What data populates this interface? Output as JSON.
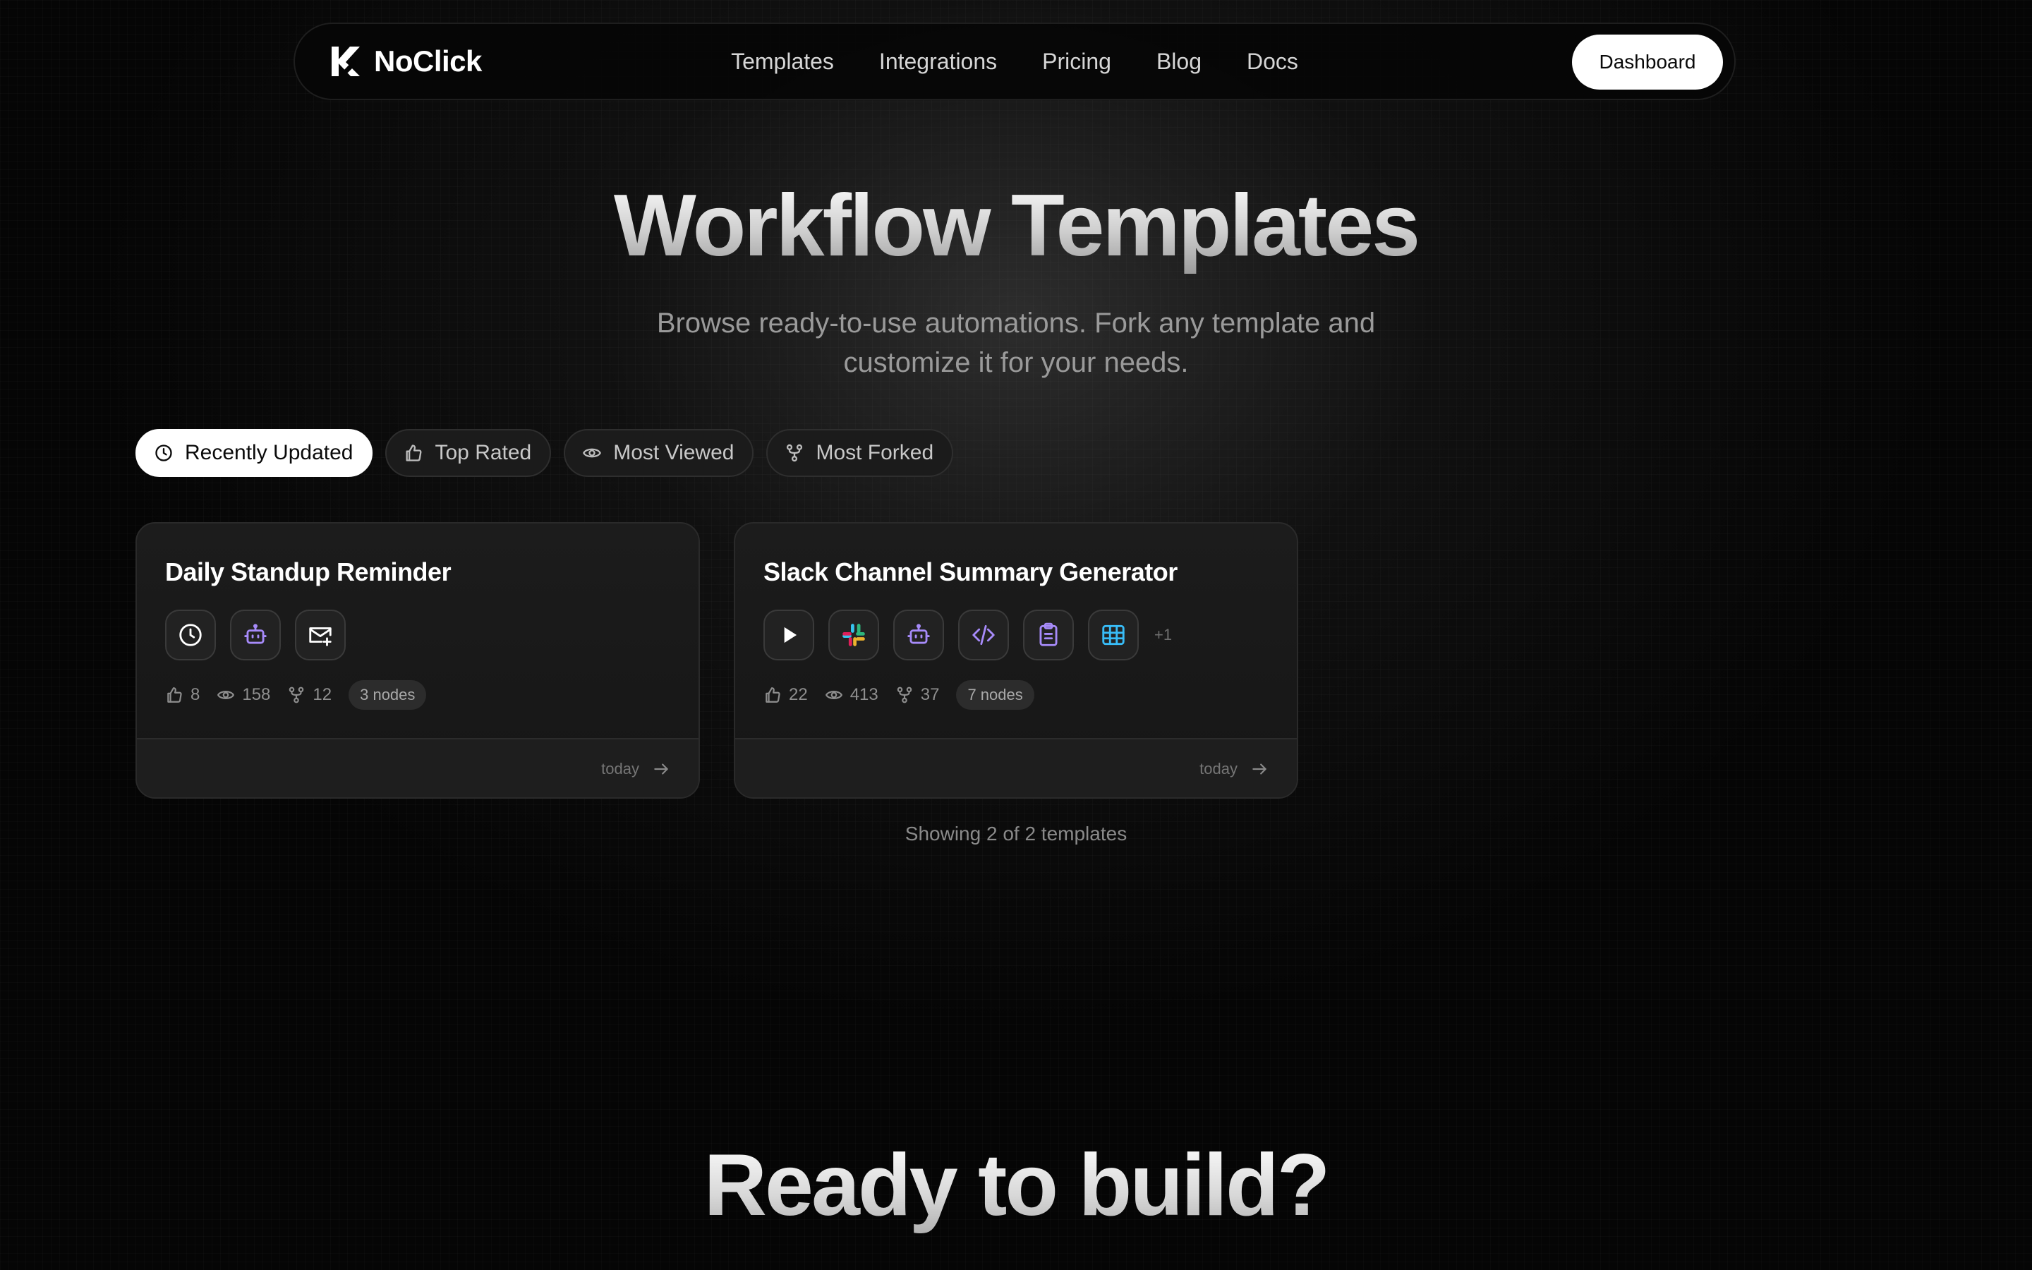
{
  "navbar": {
    "brand": "NoClick",
    "links": [
      "Templates",
      "Integrations",
      "Pricing",
      "Blog",
      "Docs"
    ],
    "dashboard_label": "Dashboard"
  },
  "hero": {
    "title": "Workflow Templates",
    "subtitle": "Browse ready-to-use automations. Fork any template and customize it for your needs."
  },
  "filters": [
    {
      "label": "Recently Updated",
      "icon": "clock-icon",
      "active": true
    },
    {
      "label": "Top Rated",
      "icon": "thumbs-up-icon",
      "active": false
    },
    {
      "label": "Most Viewed",
      "icon": "eye-icon",
      "active": false
    },
    {
      "label": "Most Forked",
      "icon": "fork-icon",
      "active": false
    }
  ],
  "templates": [
    {
      "title": "Daily Standup Reminder",
      "icons": [
        "clock-icon",
        "robot-icon",
        "mail-plus-icon"
      ],
      "likes": "8",
      "views": "158",
      "forks": "12",
      "nodes": "3 nodes",
      "updated": "today"
    },
    {
      "title": "Slack Channel Summary Generator",
      "icons": [
        "play-icon",
        "slack-icon",
        "robot-icon",
        "code-icon",
        "clipboard-icon",
        "table-icon"
      ],
      "more": "+1",
      "likes": "22",
      "views": "413",
      "forks": "37",
      "nodes": "7 nodes",
      "updated": "today"
    }
  ],
  "results": {
    "showing": "Showing 2 of 2 templates"
  },
  "cta": {
    "title": "Ready to build?"
  },
  "colors": {
    "background": "#050505",
    "accent_purple": "#a78bfa",
    "accent_blue": "#38bdf8",
    "pill_active_bg": "#ffffff"
  }
}
